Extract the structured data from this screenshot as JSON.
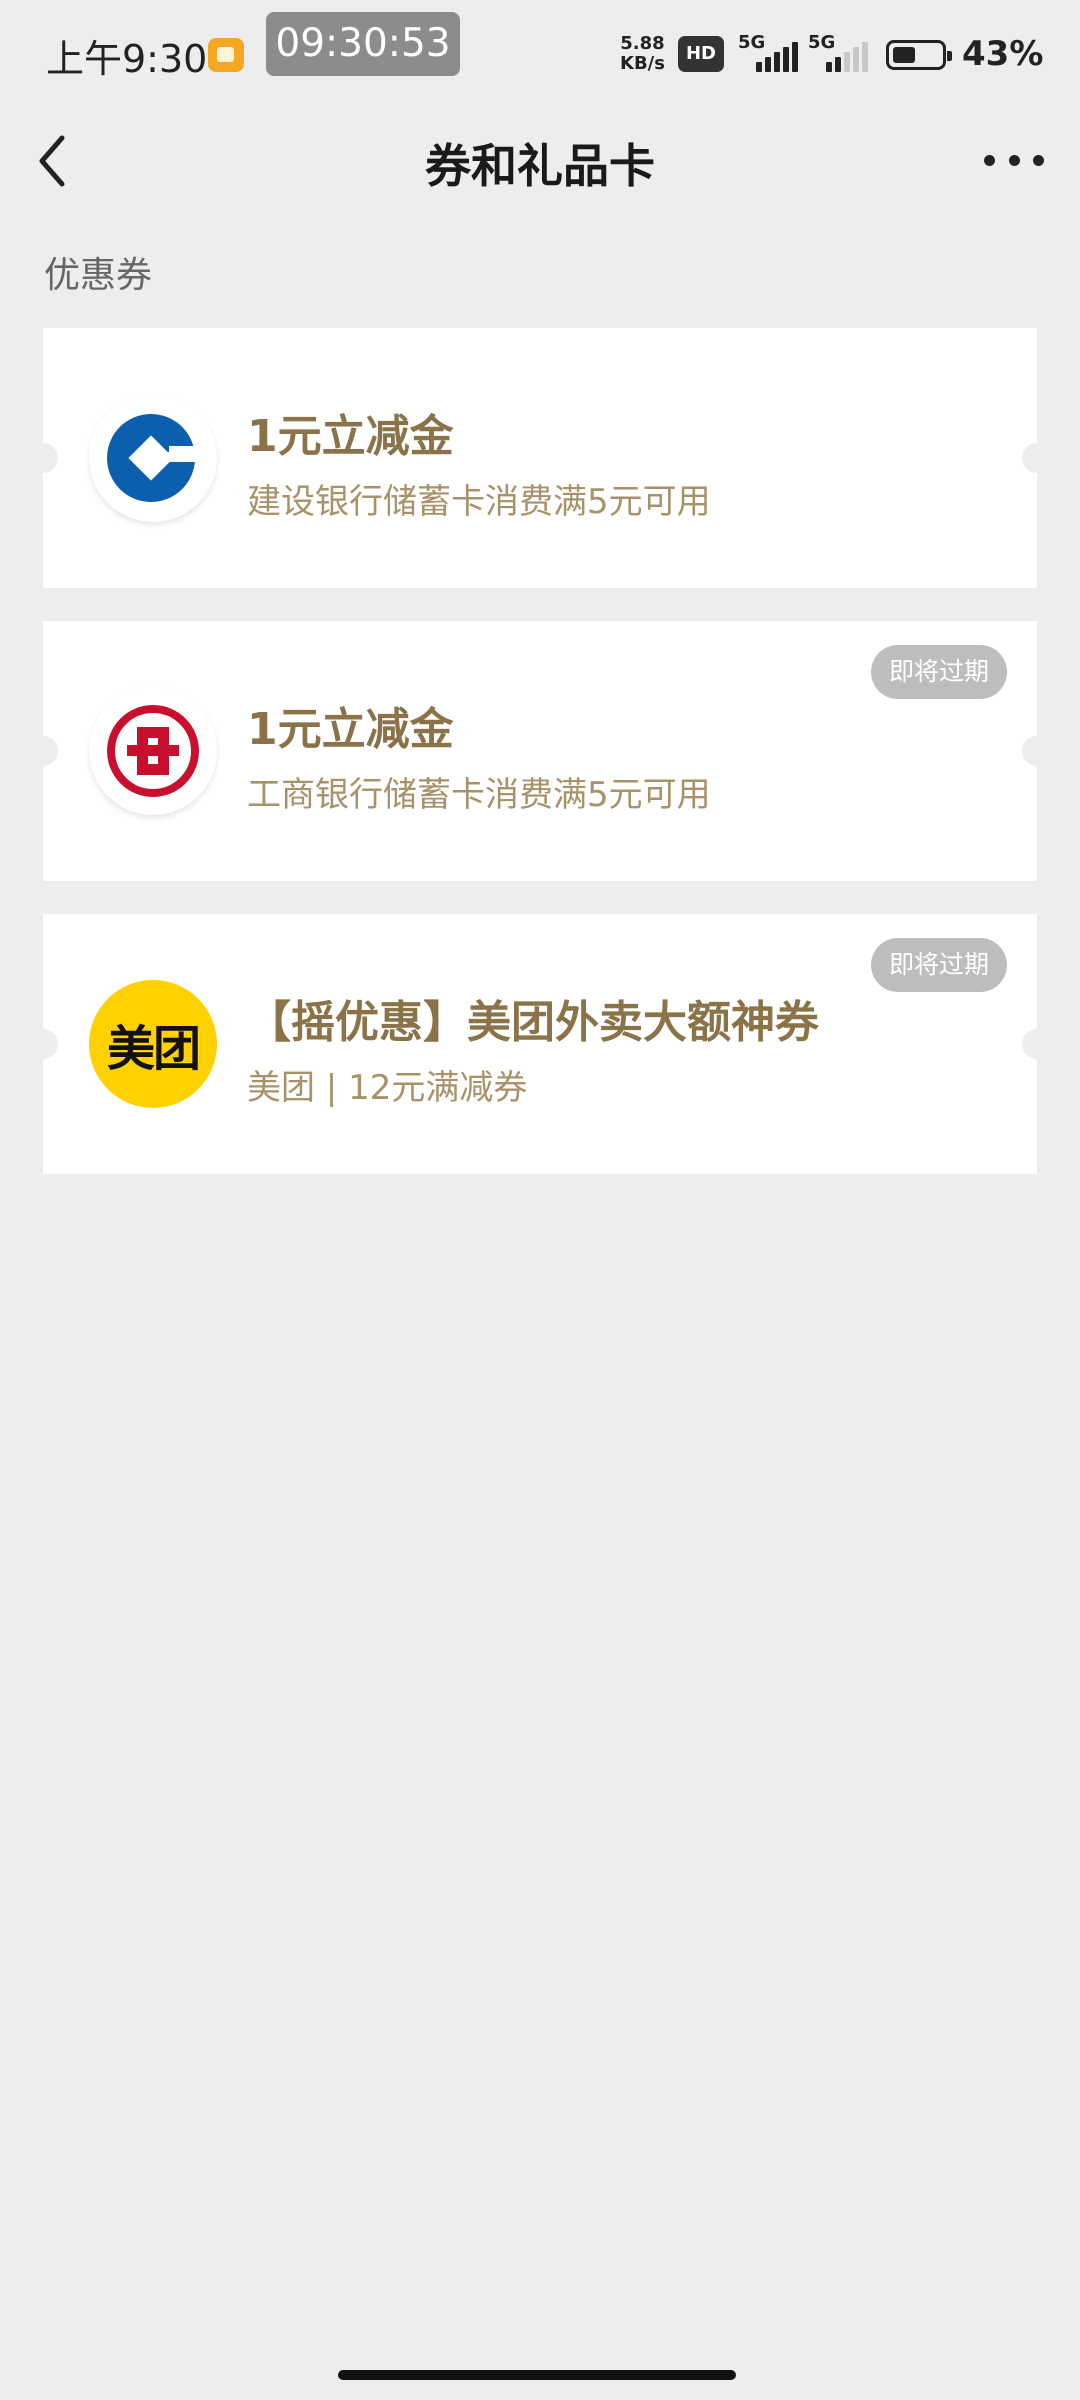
{
  "status_bar": {
    "time": "上午9:30",
    "clock_pill": "09:30:53",
    "net_speed_value": "5.88",
    "net_speed_unit": "KB/s",
    "hd_badge": "HD",
    "signal1_label": "5G",
    "signal2_label": "5G",
    "battery_percent": "43%"
  },
  "nav": {
    "title": "券和礼品卡"
  },
  "section": {
    "title": "优惠券"
  },
  "coupons": [
    {
      "logo": "ccb-logo-icon",
      "title": "1元立减金",
      "desc": "建设银行储蓄卡消费满5元可用",
      "badge": ""
    },
    {
      "logo": "icbc-logo-icon",
      "title": "1元立减金",
      "desc": "工商银行储蓄卡消费满5元可用",
      "badge": "即将过期"
    },
    {
      "logo_text": "美团",
      "title": "【摇优惠】美团外卖大额神券",
      "desc": "美团 | 12元满减券",
      "badge": "即将过期"
    }
  ],
  "colors": {
    "accent_title": "#8a7348",
    "accent_desc": "#a8926a",
    "ccb_blue": "#0b5fae",
    "icbc_red": "#c8102e",
    "meituan_yellow": "#ffd100"
  }
}
